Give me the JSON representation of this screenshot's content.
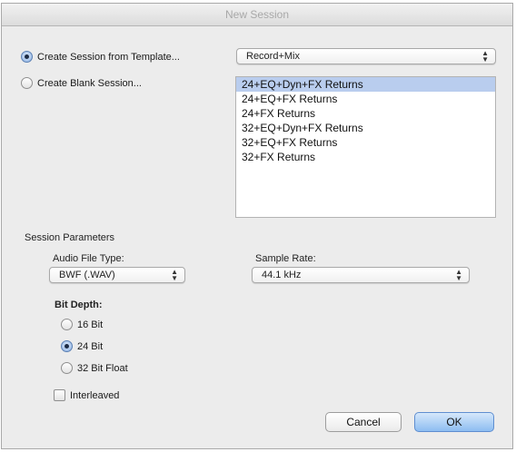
{
  "window": {
    "title": "New Session"
  },
  "create_options": {
    "from_template_label": "Create Session from Template...",
    "blank_label": "Create Blank Session...",
    "selected": "from_template"
  },
  "template_group": {
    "value": "Record+Mix"
  },
  "template_list": {
    "items": [
      "24+EQ+Dyn+FX Returns",
      "24+EQ+FX Returns",
      "24+FX Returns",
      "32+EQ+Dyn+FX Returns",
      "32+EQ+FX Returns",
      "32+FX Returns"
    ],
    "selected_index": 0
  },
  "session_parameters": {
    "heading": "Session Parameters",
    "audio_file_type": {
      "label": "Audio File Type:",
      "value": "BWF (.WAV)"
    },
    "sample_rate": {
      "label": "Sample Rate:",
      "value": "44.1 kHz"
    },
    "bit_depth": {
      "label": "Bit Depth:",
      "options": [
        "16 Bit",
        "24 Bit",
        "32 Bit Float"
      ],
      "selected_index": 1
    },
    "interleaved": {
      "label": "Interleaved",
      "checked": false
    }
  },
  "buttons": {
    "cancel": "Cancel",
    "ok": "OK"
  },
  "colors": {
    "selection": "#b9cdee",
    "default_button": "#8dbdf1"
  }
}
